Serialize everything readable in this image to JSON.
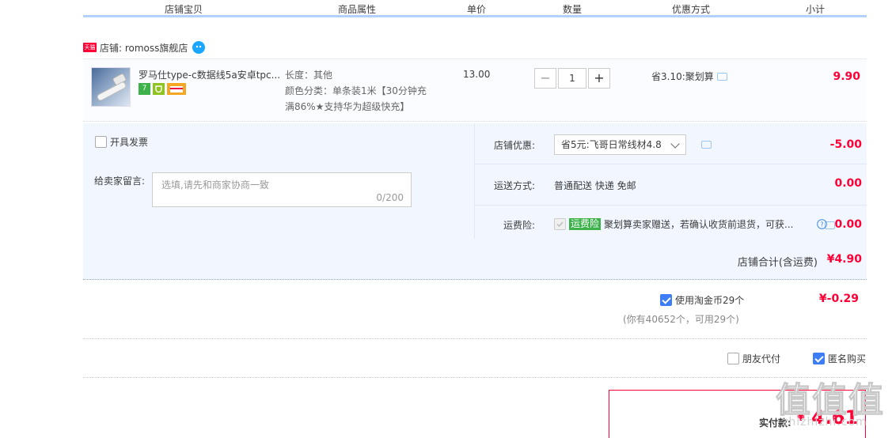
{
  "header": {
    "col_item": "店铺宝贝",
    "col_attr": "商品属性",
    "col_price": "单价",
    "col_qty": "数量",
    "col_promo": "优惠方式",
    "col_subtotal": "小计"
  },
  "shop": {
    "badge": "天猫",
    "name": "店铺: romoss旗舰店"
  },
  "item": {
    "title": "罗马仕type-c数据线5a安卓tpc...",
    "service_icons": [
      "7-day-return-icon",
      "guarantee-icon",
      "card-payment-icon"
    ],
    "attr_length": "长度：其他",
    "attr_color_line1": "颜色分类：单条装1米【30分钟充",
    "attr_color_line2": "满86%★支持华为超级快充】",
    "unit_price": "13.00",
    "quantity": "1",
    "qty_minus": "−",
    "qty_plus": "+",
    "promo": "省3.10:聚划算",
    "subtotal": "9.90"
  },
  "options": {
    "invoice_label": "开具发票",
    "memo_label": "给卖家留言:",
    "memo_placeholder": "选填,请先和商家协商一致",
    "memo_counter": "0/200",
    "shop_discount_label": "店铺优惠:",
    "shop_discount_value": "省5元:飞哥日常线材4.8",
    "shop_discount_amount": "-5.00",
    "shipping_label": "运送方式:",
    "shipping_value": "普通配送 快递 免邮",
    "shipping_amount": "0.00",
    "insurance_label": "运费险:",
    "insurance_tag": "运费险",
    "insurance_text": "聚划算卖家赠送，若确认收货前退货，可获...",
    "insurance_amount": "0.00"
  },
  "shop_total": {
    "label": "店铺合计(含运费)",
    "value": "¥4.90"
  },
  "coin": {
    "label": "使用淘金币29个",
    "amount": "¥-0.29",
    "note": "(你有40652个，可用29个)"
  },
  "bottom": {
    "friend_pay": "朋友代付",
    "anonymous": "匿名购买"
  },
  "pay": {
    "label": "实付款:",
    "currency": "¥",
    "amount": "4.61"
  },
  "watermark": {
    "logo": "值值值",
    "site": "zhizhizhi.com"
  },
  "colors": {
    "accent_red": "#ff0036",
    "header_line": "#b2d1ff",
    "panel_bg": "#f2f7ff",
    "checkbox_blue": "#3d7df5",
    "insurance_green": "#3db24b"
  }
}
